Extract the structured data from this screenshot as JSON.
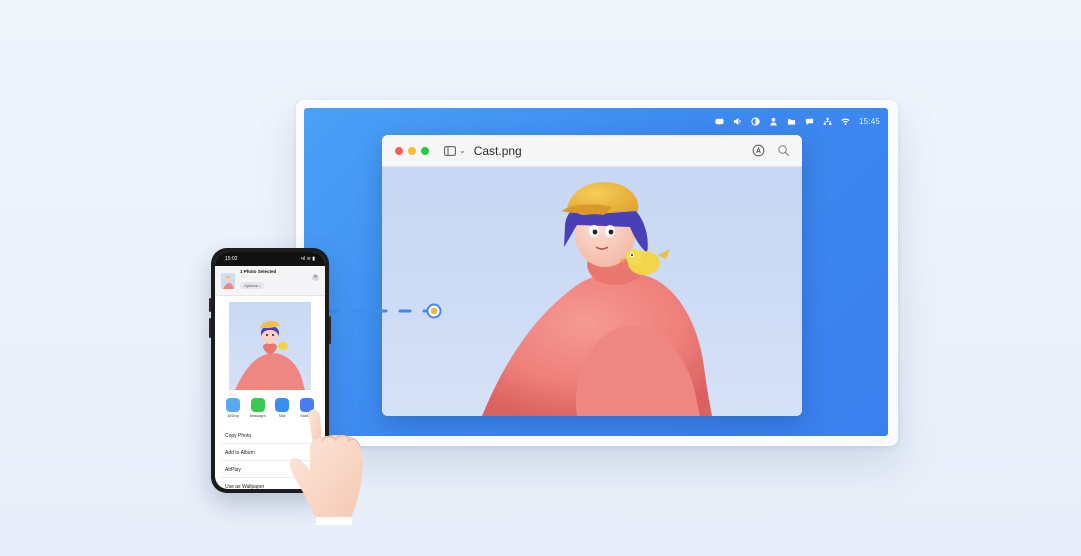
{
  "menubar": {
    "icons": [
      "cc-icon",
      "volume-icon",
      "contrast-icon",
      "user-icon",
      "folder-icon",
      "message-icon",
      "network-icon",
      "wifi-icon"
    ],
    "time": "15:45"
  },
  "window": {
    "title": "Cast.png",
    "toolbar_icons": [
      "markup-icon",
      "search-icon"
    ]
  },
  "phone": {
    "status_time": "15:02",
    "status_right": "•ıl ≋ ▮",
    "share_title": "1 Photo Selected",
    "share_options": "Options ›",
    "apps": [
      {
        "label": "AirDrop",
        "color": "#5aa8f2"
      },
      {
        "label": "Messages",
        "color": "#38c94f"
      },
      {
        "label": "Mail",
        "color": "#3a8ef0"
      },
      {
        "label": "Baiduyu",
        "color": "#4b7df0"
      }
    ],
    "actions": [
      "Copy Photo",
      "Add to Album",
      "AirPlay",
      "Use as Wallpaper"
    ]
  },
  "colors": {
    "desktop": "#3d8af0",
    "connector": "#3d8af0",
    "connector_dot": "#f5b53a"
  }
}
